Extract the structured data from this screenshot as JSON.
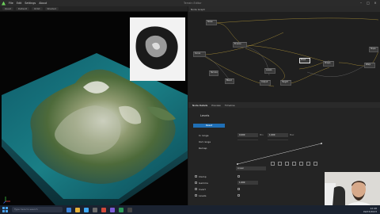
{
  "app": {
    "window_title": "Terrain Editor",
    "menu": [
      "File",
      "Edit",
      "Settings",
      "About"
    ]
  },
  "viewport": {
    "toolbar": [
      "Quad",
      "Default",
      "Orbit",
      "Shaded"
    ]
  },
  "graph": {
    "title": "Node Graph",
    "nodes": [
      "Noise",
      "Erosion",
      "Curve",
      "Terrace",
      "Blend",
      "Levels",
      "Output",
      "Mask",
      "Shape",
      "Warp",
      "Height",
      "Slope"
    ]
  },
  "inspector": {
    "tabs": [
      "Node Details",
      "Preview",
      "Timeline"
    ],
    "node_title": "Levels",
    "reset_label": "Reset",
    "params": {
      "in_range": {
        "label": "In range",
        "min": "0.000",
        "min_unit": "Min",
        "max": "1.000",
        "max_unit": "Max"
      },
      "out_range": {
        "label": "Out range",
        "min": "0.000",
        "min_unit": "Min",
        "max": "1.000",
        "max_unit": "Max"
      },
      "remap": {
        "label": "Remap"
      },
      "interp": "Linear",
      "clamp": {
        "label": "Clamp"
      },
      "gamma": {
        "label": "Gamma",
        "value": "1.000"
      },
      "invert": {
        "label": "Invert"
      },
      "levels": {
        "label": "Levels"
      }
    }
  },
  "taskbar": {
    "search_placeholder": "Type here to search",
    "time": "12:48",
    "date": "09/03/2023"
  }
}
